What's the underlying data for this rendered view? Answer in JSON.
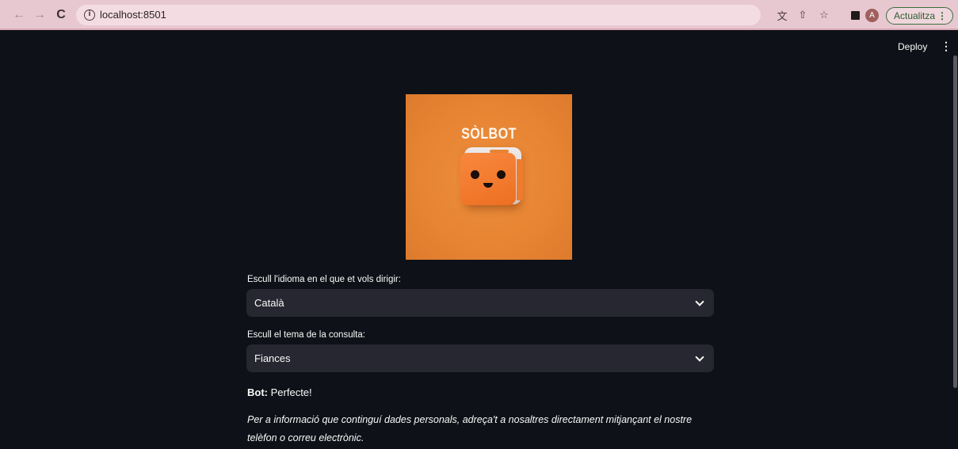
{
  "browser": {
    "url": "localhost:8501",
    "avatar_letter": "A",
    "update_label": "Actualitza"
  },
  "header": {
    "deploy_label": "Deploy"
  },
  "logo": {
    "title": "SÒLBOT"
  },
  "form": {
    "language_label": "Escull l'idioma en el que et vols dirigir:",
    "language_value": "Català",
    "topic_label": "Escull el tema de la consulta:",
    "topic_value": "Fiances"
  },
  "chat": {
    "speaker": "Bot:",
    "message": "Perfecte!",
    "info_line1": "Per a informació que continguí dades personals, adreça't a nosaltres directament mitjançant el nostre",
    "info_line2": "telèfon o correu electrònic."
  },
  "colors": {
    "background": "#0e1117",
    "select_bg": "#262730",
    "chrome_bg": "#e8c8d0",
    "logo_orange": "#e78433"
  }
}
